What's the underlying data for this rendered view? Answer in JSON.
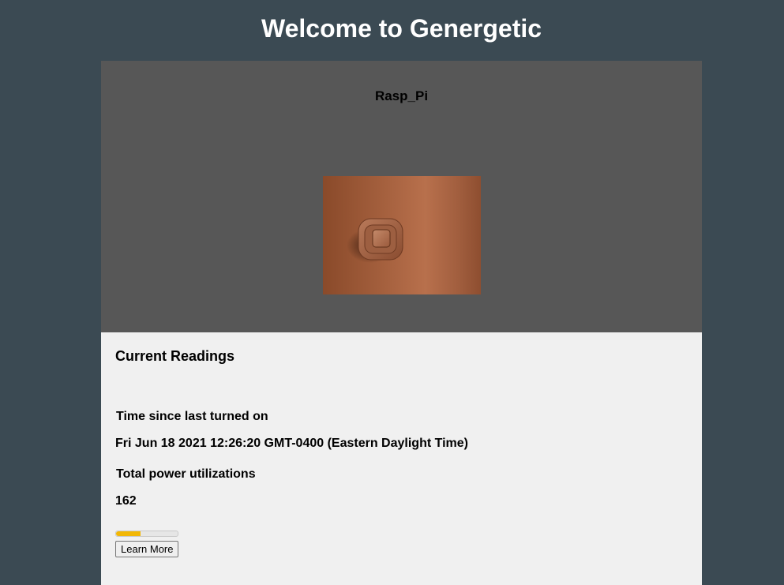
{
  "header": {
    "title": "Welcome to Genergetic"
  },
  "device": {
    "name": "Rasp_Pi",
    "image": "light-switch-photo"
  },
  "readings": {
    "heading": "Current Readings",
    "time_label": "Time since last turned on",
    "time_value": "Fri Jun 18 2021 12:26:20 GMT-0400 (Eastern Daylight Time)",
    "power_label": "Total power utilizations",
    "power_value": "162",
    "progress_fraction": 0.4,
    "progress_color": "#f2b705",
    "learn_more_label": "Learn More"
  },
  "colors": {
    "background": "#3b4a53",
    "card_top": "#575757",
    "card_body": "#f0f0f0"
  }
}
